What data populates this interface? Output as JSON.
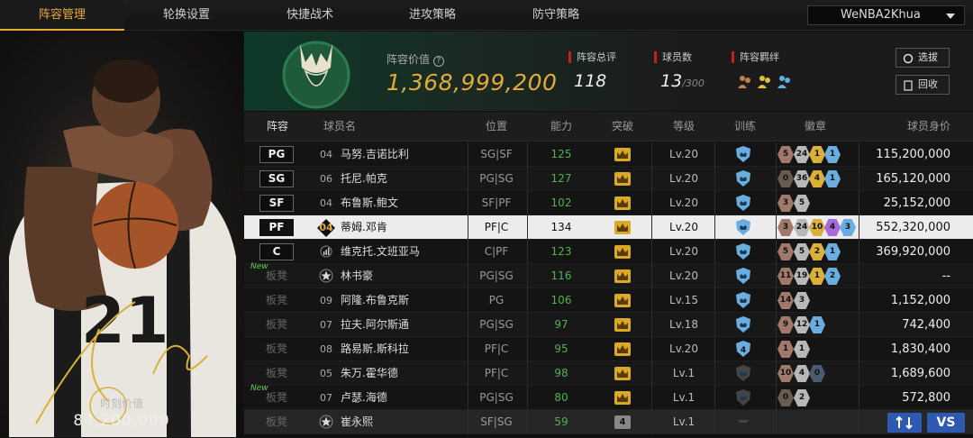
{
  "tabs": [
    "阵容管理",
    "轮换设置",
    "快捷战术",
    "进攻策略",
    "防守策略"
  ],
  "user": {
    "name": "WeNBA2Khua"
  },
  "featured": {
    "jersey": "21",
    "value_label": "时刻价值",
    "value": "84,200,000"
  },
  "team": {
    "value_label": "阵容价值",
    "value": "1,368,999,200",
    "rating_label": "阵容总评",
    "rating": "118",
    "count_label": "球员数",
    "count": "13",
    "count_max": "/300",
    "bond_label": "阵容羁绊",
    "logo_text": "BUCKS"
  },
  "buttons": {
    "pick": "选拔",
    "recycle": "回收",
    "vs": "VS"
  },
  "columns": [
    "阵容",
    "球员名",
    "位置",
    "能力",
    "突破",
    "等级",
    "训练",
    "徽章",
    "球员身价"
  ],
  "colors": {
    "accent": "#e6a93c",
    "ability_green": "#4fb24f",
    "bucks_green": "#0e3a2a",
    "button_blue": "#2d5ab0"
  },
  "players": [
    {
      "slot": "PG",
      "num": "04",
      "name": "马努.吉诺比利",
      "pos": "SG|SF",
      "ability": "125",
      "breakthrough": "",
      "level": "Lv.20",
      "badges": [
        {
          "v": "5",
          "c": "#a0796a"
        },
        {
          "v": "24",
          "c": "#b8b8b8"
        },
        {
          "v": "1",
          "c": "#d9b13a"
        },
        {
          "v": "1",
          "c": "#6aaee0"
        }
      ],
      "price": "115,200,000",
      "new": false,
      "selected": false
    },
    {
      "slot": "SG",
      "num": "06",
      "name": "托尼.帕克",
      "pos": "PG|SG",
      "ability": "127",
      "breakthrough": "",
      "level": "Lv.20",
      "badges": [
        {
          "v": "0",
          "c": "#6a5a50"
        },
        {
          "v": "36",
          "c": "#b8b8b8"
        },
        {
          "v": "4",
          "c": "#d9b13a"
        },
        {
          "v": "1",
          "c": "#6aaee0"
        }
      ],
      "price": "165,120,000",
      "new": false,
      "selected": false
    },
    {
      "slot": "SF",
      "num": "04",
      "name": "布鲁斯.鲍文",
      "pos": "SF|PF",
      "ability": "102",
      "breakthrough": "",
      "level": "Lv.20",
      "badges": [
        {
          "v": "3",
          "c": "#a0796a"
        },
        {
          "v": "5",
          "c": "#b8b8b8"
        }
      ],
      "price": "25,152,000",
      "new": false,
      "selected": false
    },
    {
      "slot": "PF",
      "num": "04",
      "name": "蒂姆.邓肯",
      "pos": "PF|C",
      "ability": "134",
      "breakthrough": "",
      "level": "Lv.20",
      "badges": [
        {
          "v": "3",
          "c": "#a0796a"
        },
        {
          "v": "24",
          "c": "#b8b8b8"
        },
        {
          "v": "10",
          "c": "#d9b13a"
        },
        {
          "v": "4",
          "c": "#a86ad8"
        },
        {
          "v": "3",
          "c": "#6aaee0"
        }
      ],
      "price": "552,320,000",
      "new": false,
      "selected": true
    },
    {
      "slot": "C",
      "num": "",
      "name": "维克托.文班亚马",
      "pos": "C|PF",
      "ability": "123",
      "breakthrough": "",
      "level": "Lv.20",
      "badges": [
        {
          "v": "5",
          "c": "#a0796a"
        },
        {
          "v": "5",
          "c": "#b8b8b8"
        },
        {
          "v": "2",
          "c": "#d9b13a"
        },
        {
          "v": "1",
          "c": "#6aaee0"
        }
      ],
      "price": "369,920,000",
      "new": false,
      "selected": false
    },
    {
      "slot": "板凳",
      "num": "",
      "name": "林书豪",
      "pos": "PG|SG",
      "ability": "116",
      "breakthrough": "",
      "level": "Lv.20",
      "badges": [
        {
          "v": "11",
          "c": "#a0796a"
        },
        {
          "v": "19",
          "c": "#b8b8b8"
        },
        {
          "v": "1",
          "c": "#d9b13a"
        },
        {
          "v": "2",
          "c": "#6aaee0"
        }
      ],
      "price": "--",
      "new": true,
      "selected": false
    },
    {
      "slot": "板凳",
      "num": "09",
      "name": "阿隆.布鲁克斯",
      "pos": "PG",
      "ability": "106",
      "breakthrough": "",
      "level": "Lv.15",
      "badges": [
        {
          "v": "14",
          "c": "#a0796a"
        },
        {
          "v": "3",
          "c": "#b8b8b8"
        }
      ],
      "price": "1,152,000",
      "new": false,
      "selected": false
    },
    {
      "slot": "板凳",
      "num": "07",
      "name": "拉夫.阿尔斯通",
      "pos": "PG|SG",
      "ability": "97",
      "breakthrough": "",
      "level": "Lv.18",
      "badges": [
        {
          "v": "9",
          "c": "#a0796a"
        },
        {
          "v": "12",
          "c": "#b8b8b8"
        },
        {
          "v": "1",
          "c": "#6aaee0"
        }
      ],
      "price": "742,400",
      "new": false,
      "selected": false
    },
    {
      "slot": "板凳",
      "num": "08",
      "name": "路易斯.斯科拉",
      "pos": "PF|C",
      "ability": "95",
      "breakthrough": "",
      "level": "Lv.20",
      "badges": [
        {
          "v": "1",
          "c": "#a0796a"
        },
        {
          "v": "1",
          "c": "#b8b8b8"
        }
      ],
      "price": "1,830,400",
      "new": false,
      "selected": false
    },
    {
      "slot": "板凳",
      "num": "05",
      "name": "朱万.霍华德",
      "pos": "PF|C",
      "ability": "98",
      "breakthrough": "",
      "level": "Lv.1",
      "badges": [
        {
          "v": "10",
          "c": "#a0796a"
        },
        {
          "v": "4",
          "c": "#b8b8b8"
        },
        {
          "v": "0",
          "c": "#4a5a70"
        }
      ],
      "price": "1,689,600",
      "new": false,
      "selected": false
    },
    {
      "slot": "板凳",
      "num": "07",
      "name": "卢瑟.海德",
      "pos": "PG|SG",
      "ability": "80",
      "breakthrough": "",
      "level": "Lv.1",
      "badges": [
        {
          "v": "0",
          "c": "#6a5a50"
        },
        {
          "v": "2",
          "c": "#b8b8b8"
        }
      ],
      "price": "572,800",
      "new": true,
      "selected": false
    },
    {
      "slot": "板凳",
      "num": "",
      "name": "崔永熙",
      "pos": "SF|SG",
      "ability": "59",
      "breakthrough": "4",
      "level": "Lv.1",
      "badges": [],
      "price": "",
      "new": false,
      "selected": false
    }
  ],
  "new_tag": "New"
}
